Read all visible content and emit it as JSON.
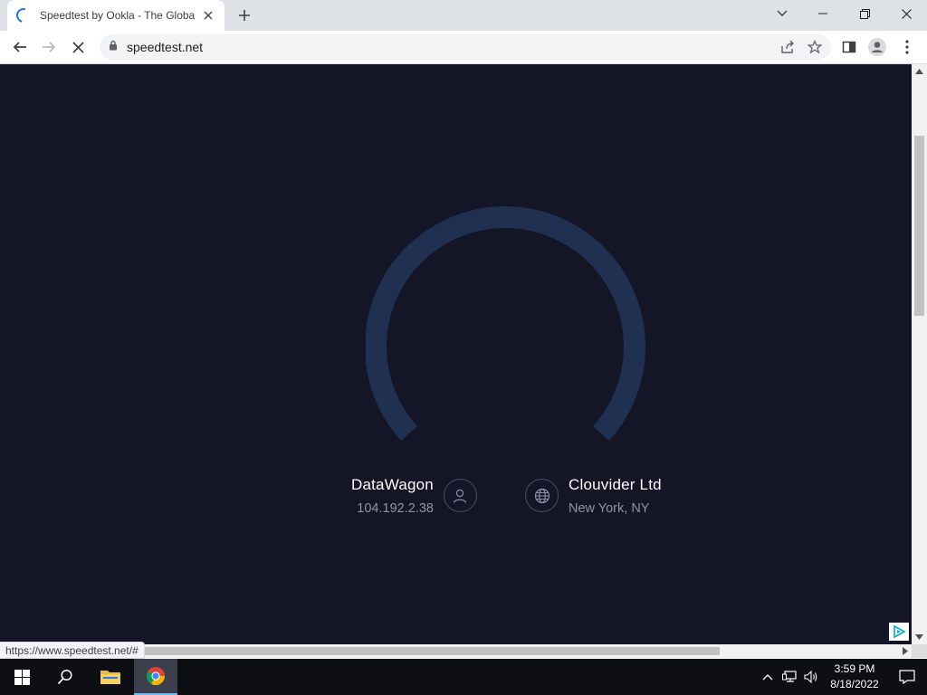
{
  "browser": {
    "tab_title": "Speedtest by Ookla - The Global Broadband Speed Test",
    "url": "speedtest.net",
    "status_url": "https://www.speedtest.net/#"
  },
  "speedtest": {
    "isp_name": "DataWagon",
    "isp_ip": "104.192.2.38",
    "server_name": "Clouvider Ltd",
    "server_location": "New York, NY",
    "gauge_color": "#1f3050",
    "background_color": "#141526"
  },
  "taskbar": {
    "time": "3:59 PM",
    "date": "8/18/2022"
  }
}
